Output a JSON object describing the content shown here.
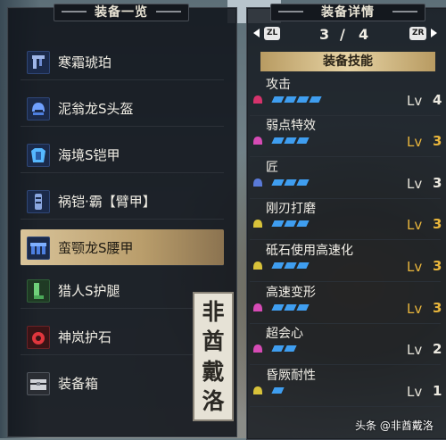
{
  "left_panel": {
    "title": "装备一览",
    "items": [
      {
        "label": "寒霜琥珀",
        "icon": "weapon-icon",
        "selected": false
      },
      {
        "label": "泥翁龙S头盔",
        "icon": "helmet-icon",
        "selected": false
      },
      {
        "label": "海境S铠甲",
        "icon": "chest-armor-icon",
        "selected": false
      },
      {
        "label": "祸铠·霸【臂甲】",
        "icon": "arm-armor-icon",
        "selected": false
      },
      {
        "label": "蛮颚龙S腰甲",
        "icon": "waist-armor-icon",
        "selected": true
      },
      {
        "label": "猎人S护腿",
        "icon": "leg-armor-icon",
        "selected": false
      },
      {
        "label": "神岚护石",
        "icon": "charm-icon",
        "selected": false
      },
      {
        "label": "装备箱",
        "icon": "equipment-box-icon",
        "selected": false
      }
    ]
  },
  "watermark": "非酋戴洛",
  "right_panel": {
    "title": "装备详情",
    "pager": {
      "left_button": "ZL",
      "right_button": "ZR",
      "current": "3",
      "separator": "/",
      "total": "4"
    },
    "skills_header": "装备技能",
    "skills": [
      {
        "name": "攻击",
        "lv_label": "Lv",
        "level": "4",
        "pips": 4,
        "maxed": false,
        "icon_color": "#d6336c"
      },
      {
        "name": "弱点特效",
        "lv_label": "Lv",
        "level": "3",
        "pips": 3,
        "maxed": true,
        "icon_color": "#d64bb5"
      },
      {
        "name": "匠",
        "lv_label": "Lv",
        "level": "3",
        "pips": 3,
        "maxed": false,
        "icon_color": "#5a7ad8"
      },
      {
        "name": "刚刃打磨",
        "lv_label": "Lv",
        "level": "3",
        "pips": 3,
        "maxed": true,
        "icon_color": "#d8c23a"
      },
      {
        "name": "砥石使用高速化",
        "lv_label": "Lv",
        "level": "3",
        "pips": 3,
        "maxed": true,
        "icon_color": "#d8c23a"
      },
      {
        "name": "高速变形",
        "lv_label": "Lv",
        "level": "3",
        "pips": 3,
        "maxed": true,
        "icon_color": "#d64bb5"
      },
      {
        "name": "超会心",
        "lv_label": "Lv",
        "level": "2",
        "pips": 2,
        "maxed": false,
        "icon_color": "#d64bb5"
      },
      {
        "name": "昏厥耐性",
        "lv_label": "Lv",
        "level": "1",
        "pips": 1,
        "maxed": false,
        "icon_color": "#d8c23a"
      }
    ]
  },
  "credit": "头条 @非酋戴洛",
  "colors": {
    "pip": "#3f9ef0",
    "maxed_level": "#e9b63c",
    "selected_row": "#d9c49a"
  }
}
